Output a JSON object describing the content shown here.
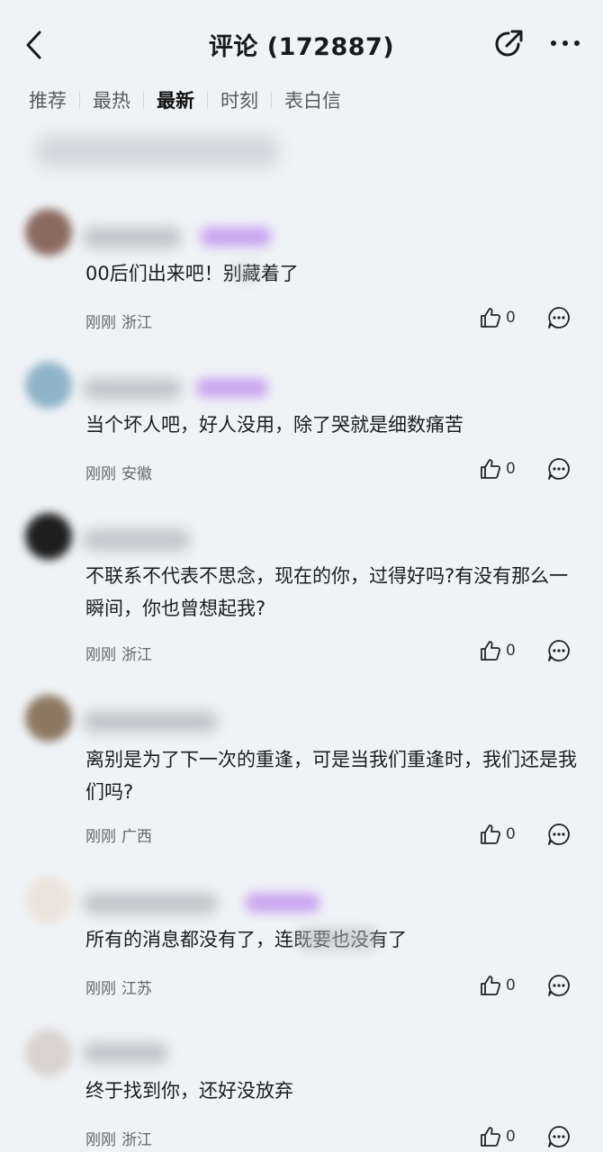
{
  "header": {
    "title": "评论 (172887)",
    "back_icon": "chevron-left-icon",
    "share_icon": "share-icon",
    "more_icon": "more-dots-icon"
  },
  "tabs": [
    {
      "label": "推荐",
      "active": false
    },
    {
      "label": "最热",
      "active": false
    },
    {
      "label": "最新",
      "active": true
    },
    {
      "label": "时刻",
      "active": false
    },
    {
      "label": "表白信",
      "active": false
    }
  ],
  "comments": [
    {
      "text": "00后们出来吧！别藏着了",
      "time": "刚刚",
      "location": "浙江",
      "likes": "0"
    },
    {
      "text": "当个坏人吧，好人没用，除了哭就是细数痛苦",
      "time": "刚刚",
      "location": "安徽",
      "likes": "0"
    },
    {
      "text": "不联系不代表不思念，现在的你，过得好吗?有没有那么一瞬间，你也曾想起我?",
      "time": "刚刚",
      "location": "浙江",
      "likes": "0"
    },
    {
      "text": "离别是为了下一次的重逢，可是当我们重逢时，我们还是我们吗?",
      "time": "刚刚",
      "location": "广西",
      "likes": "0"
    },
    {
      "text": "所有的消息都没有了，连既要也没有了",
      "time": "刚刚",
      "location": "江苏",
      "likes": "0"
    },
    {
      "text": "终于找到你，还好没放弃",
      "time": "刚刚",
      "location": "浙江",
      "likes": "0"
    }
  ],
  "colors": {
    "background": "#f0f3f6",
    "badge": "#c9a6f0"
  }
}
